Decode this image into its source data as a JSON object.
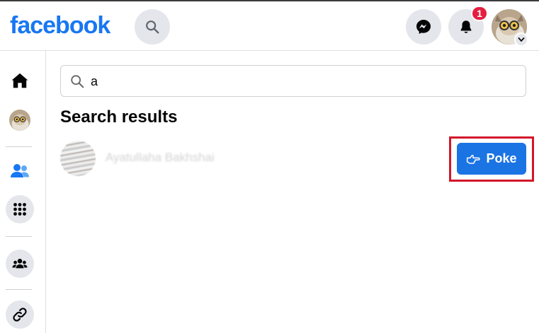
{
  "header": {
    "logo_text": "facebook",
    "notification_count": "1"
  },
  "search": {
    "query": "a"
  },
  "results": {
    "title": "Search results",
    "items": [
      {
        "name": "Ayatullaha Bakhshai",
        "action_label": "Poke"
      }
    ]
  },
  "sidebar": {
    "items": [
      {
        "icon": "home-icon"
      },
      {
        "icon": "profile-avatar"
      },
      {
        "icon": "friends-icon"
      },
      {
        "icon": "apps-grid-icon"
      },
      {
        "icon": "groups-icon"
      },
      {
        "icon": "link-icon"
      }
    ]
  },
  "colors": {
    "brand_blue": "#1877f2",
    "button_blue": "#1b74e4",
    "highlight_red": "#d3162a",
    "badge_red": "#e41e3f",
    "icon_gray_bg": "#e4e6eb"
  }
}
